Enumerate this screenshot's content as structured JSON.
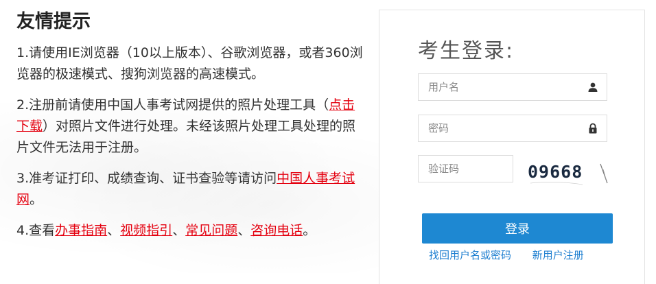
{
  "notice": {
    "title": "友情提示",
    "item1": "1.请使用IE浏览器（10以上版本）、谷歌浏览器，或者360浏览器的极速模式、搜狗浏览器的高速模式。",
    "item2_before": "2.注册前请使用中国人事考试网提供的照片处理工具（",
    "item2_link": "点击下载",
    "item2_after": "）对照片文件进行处理。未经该照片处理工具处理的照片文件无法用于注册。",
    "item3_before": "3.准考证打印、成绩查询、证书查验等请访问",
    "item3_link": "中国人事考试网",
    "item3_after": "。",
    "item4_before": "4.查看",
    "item4_link1": "办事指南",
    "sep1": "、",
    "item4_link2": "视频指引",
    "sep2": "、",
    "item4_link3": "常见问题",
    "sep3": "、",
    "item4_link4": "咨询电话",
    "item4_after": "。"
  },
  "login": {
    "title": "考生登录:",
    "username_placeholder": "用户名",
    "password_placeholder": "密码",
    "captcha_placeholder": "验证码",
    "captcha_text": "09668",
    "submit_label": "登录",
    "forgot_link": "找回用户名或密码",
    "register_link": "新用户注册"
  },
  "colors": {
    "link_red": "#e4000f",
    "button_blue": "#1e88d2",
    "link_blue": "#1e7fd0"
  },
  "icons": {
    "username": "user-icon",
    "password": "lock-icon"
  }
}
